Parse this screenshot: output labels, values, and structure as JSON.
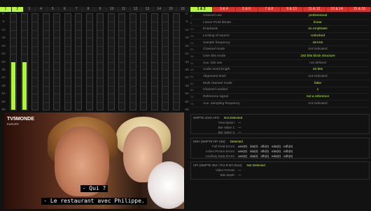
{
  "channels": [
    "1",
    "2",
    "3",
    "4",
    "5",
    "6",
    "7",
    "8",
    "9",
    "10",
    "11",
    "12",
    "13",
    "14",
    "15",
    "16"
  ],
  "channel_pairs": [
    "1 & 2",
    "3 & 4",
    "5 & 6",
    "7 & 8",
    "9 & 10",
    "11 & 12",
    "13 & 14",
    "15 & 16"
  ],
  "scale": [
    "0",
    "-6",
    "-12",
    "-18",
    "-20",
    "-24",
    "-30",
    "-36",
    "-42",
    "-48",
    "-54",
    "-60",
    "-66"
  ],
  "levels": [
    0.5,
    0.5,
    0,
    0,
    0,
    0,
    0,
    0,
    0,
    0,
    0,
    0,
    0,
    0,
    0,
    0
  ],
  "status": [
    {
      "k": "Channel use",
      "v": "professional"
    },
    {
      "k": "Linear PCM bitrate",
      "v": "linear"
    },
    {
      "k": "Emphasis",
      "v": "no emphasis"
    },
    {
      "k": "Locking of source",
      "v": "Unlocked"
    },
    {
      "k": "Sample frequency",
      "v": "48 kHz"
    },
    {
      "k": "Channel mode",
      "v": "not indicated"
    },
    {
      "k": "User bits mode",
      "v": "192 bits block structure"
    },
    {
      "k": "Aux. bits use",
      "v": "not defined"
    },
    {
      "k": "Audio word length",
      "v": "20 bits"
    },
    {
      "k": "Alignment level",
      "v": "not indicated"
    },
    {
      "k": "Multi channel mode",
      "v": "false"
    },
    {
      "k": "Channel number",
      "v": "1"
    },
    {
      "k": "Reference signal",
      "v": "not a reference"
    },
    {
      "k": "Aux. sampling frequency",
      "v": "not indicated"
    }
  ],
  "smpte2016": {
    "title": "SMPTE 2016 AFD:",
    "state": "Not Detected",
    "rows": [
      {
        "k": "Description:",
        "v": "---"
      },
      {
        "k": "Bar Value 1:",
        "v": "---"
      },
      {
        "k": "Bar Value 2:",
        "v": "---"
      }
    ]
  },
  "edh": {
    "title": "EDH (SMPTE RP 165):",
    "state": "Detected",
    "rows": [
      {
        "k": "Full Field Errors:",
        "v": [
          "uee(0)",
          "ida(0)",
          "idh(0)",
          "eda(0)",
          "edh(0)"
        ]
      },
      {
        "k": "Active Picture Errors:",
        "v": [
          "uee(0)",
          "ida(0)",
          "idh(0)",
          "eda(0)",
          "edh(0)"
        ]
      },
      {
        "k": "Ancillary Data Errors:",
        "v": [
          "uee(0)",
          "ida(0)",
          "idh(0)",
          "eda(0)",
          "edh(0)"
        ]
      }
    ]
  },
  "vpid": {
    "title": "VPI (SMPTE 352 / ITU-R BT.1614):",
    "state": "Not Detected",
    "rows": [
      {
        "k": "Video Format:",
        "v": "---"
      },
      {
        "k": "Bits depth:",
        "v": "---"
      }
    ]
  },
  "video": {
    "logo": "TV5MONDE",
    "logo_sub": "EUROPE",
    "subtitle1": "- Qui ?",
    "subtitle2": "- Le restaurant avec Philippe."
  }
}
